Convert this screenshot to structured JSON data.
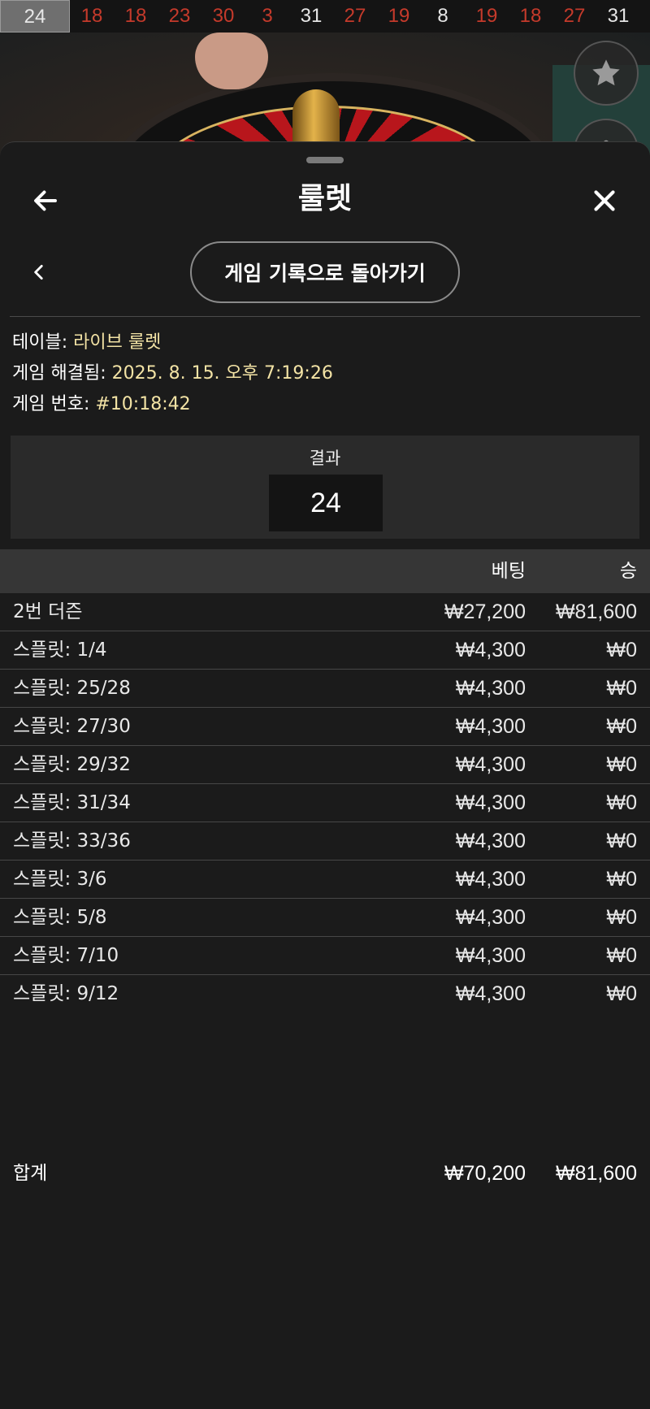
{
  "recent_results": {
    "current": "24",
    "items": [
      {
        "n": "18",
        "color": "red"
      },
      {
        "n": "18",
        "color": "red"
      },
      {
        "n": "23",
        "color": "red"
      },
      {
        "n": "30",
        "color": "red"
      },
      {
        "n": "3",
        "color": "red"
      },
      {
        "n": "31",
        "color": "black"
      },
      {
        "n": "27",
        "color": "red"
      },
      {
        "n": "19",
        "color": "red"
      },
      {
        "n": "8",
        "color": "black"
      },
      {
        "n": "19",
        "color": "red"
      },
      {
        "n": "18",
        "color": "red"
      },
      {
        "n": "27",
        "color": "red"
      },
      {
        "n": "31",
        "color": "black"
      }
    ]
  },
  "colors": {
    "red_number": "#c53a2b",
    "value_text": "#f3e3a5",
    "panel_bg": "#1b1b1b",
    "header_bg": "#363636"
  },
  "side_buttons": [
    "star-icon",
    "more-icon"
  ],
  "panel": {
    "title": "룰렛",
    "back_icon": "arrow-left-icon",
    "close_icon": "close-icon",
    "prev_icon": "chevron-left-icon",
    "back_to_history_label": "게임 기록으로 돌아가기"
  },
  "game_info": {
    "table_label": "테이블:",
    "table_value": "라이브 룰렛",
    "resolved_label": "게임 해결됨:",
    "resolved_value": "2025. 8. 15. 오후 7:19:26",
    "game_no_label": "게임 번호:",
    "game_no_value": "#10:18:42"
  },
  "result": {
    "label": "결과",
    "value": "24"
  },
  "bets": {
    "header_bet": "베팅",
    "header_win": "승",
    "rows": [
      {
        "name": "2번 더즌",
        "bet": "₩27,200",
        "win": "₩81,600"
      },
      {
        "name": "스플릿: 1/4",
        "bet": "₩4,300",
        "win": "₩0"
      },
      {
        "name": "스플릿: 25/28",
        "bet": "₩4,300",
        "win": "₩0"
      },
      {
        "name": "스플릿: 27/30",
        "bet": "₩4,300",
        "win": "₩0"
      },
      {
        "name": "스플릿: 29/32",
        "bet": "₩4,300",
        "win": "₩0"
      },
      {
        "name": "스플릿: 31/34",
        "bet": "₩4,300",
        "win": "₩0"
      },
      {
        "name": "스플릿: 33/36",
        "bet": "₩4,300",
        "win": "₩0"
      },
      {
        "name": "스플릿: 3/6",
        "bet": "₩4,300",
        "win": "₩0"
      },
      {
        "name": "스플릿: 5/8",
        "bet": "₩4,300",
        "win": "₩0"
      },
      {
        "name": "스플릿: 7/10",
        "bet": "₩4,300",
        "win": "₩0"
      },
      {
        "name": "스플릿: 9/12",
        "bet": "₩4,300",
        "win": "₩0"
      }
    ],
    "total": {
      "name": "합계",
      "bet": "₩70,200",
      "win": "₩81,600"
    }
  }
}
